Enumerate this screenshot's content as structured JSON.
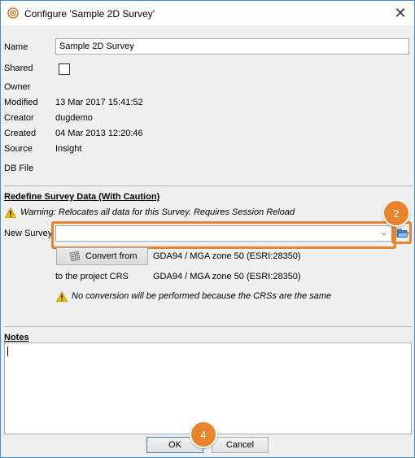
{
  "window": {
    "title": "Configure 'Sample 2D Survey'"
  },
  "fields": {
    "name_label": "Name",
    "name_value": "Sample 2D Survey",
    "shared_label": "Shared",
    "owner_label": "Owner",
    "modified_label": "Modified",
    "modified_value": "13 Mar 2017 15:41:52",
    "creator_label": "Creator",
    "creator_value": "dugdemo",
    "created_label": "Created",
    "created_value": "04 Mar 2013 12:20:46",
    "source_label": "Source",
    "source_value": "Insight",
    "dbfile_label": "DB File"
  },
  "redefine": {
    "title": "Redefine Survey Data (With Caution)",
    "warning": "Warning: Relocates all data for this Survey. Requires Session Reload",
    "new_survey_label": "New Survey",
    "convert_button": "Convert from",
    "convert_from_value": "GDA94 / MGA zone 50 (ESRI:28350)",
    "to_project_label": "to the project CRS",
    "to_project_value": "GDA94 / MGA zone 50 (ESRI:28350)",
    "no_conversion_note": "No conversion will be performed because the CRSs are the same"
  },
  "notes": {
    "title": "Notes"
  },
  "buttons": {
    "ok": "OK",
    "cancel": "Cancel"
  },
  "badges": {
    "browse_step": "2",
    "ok_step": "4"
  },
  "colors": {
    "highlight": "#e8852c",
    "window_border": "#3c8ed0",
    "warning": "#f2c200"
  },
  "icons": {
    "title": "target-icon",
    "close": "close-icon",
    "warning": "warning-icon",
    "browse": "folder-open-icon",
    "convert": "grid-icon",
    "dropdown": "chevron-down-icon"
  }
}
